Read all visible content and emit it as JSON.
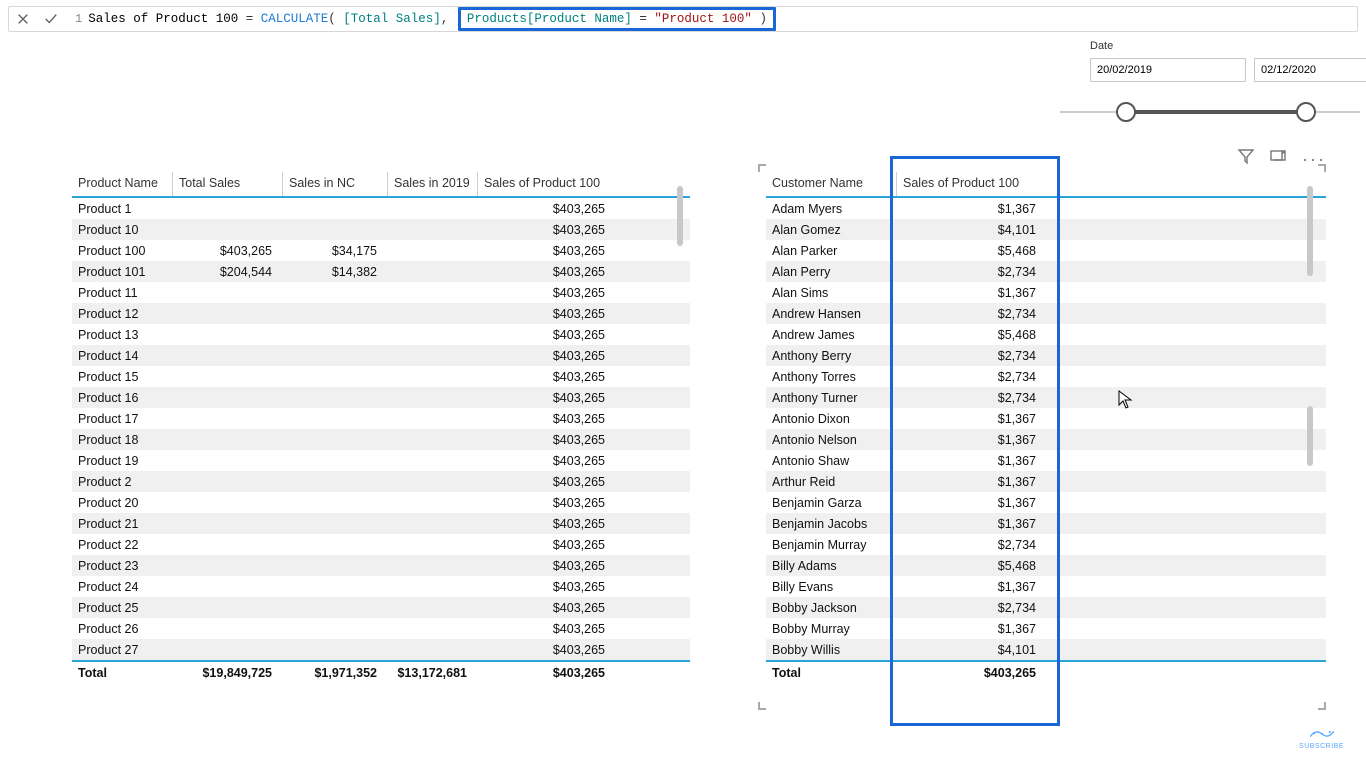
{
  "formula": {
    "line_no": "1",
    "measure_name": "Sales of Product 100",
    "equals": " = ",
    "func": "CALCULATE",
    "open": "(",
    "arg1_open": " [",
    "arg1": "Total Sales",
    "arg1_close": "]",
    "comma": ", ",
    "filter_table": "Products",
    "filter_col_open": "[",
    "filter_col": "Product Name",
    "filter_col_close": "]",
    "filter_op": " = ",
    "filter_val": "\"Product 100\"",
    "close": " )"
  },
  "date_slicer": {
    "label": "Date",
    "start": "20/02/2019",
    "end": "02/12/2020"
  },
  "products_table": {
    "headers": [
      "Product Name",
      "Total Sales",
      "Sales in NC",
      "Sales in 2019",
      "Sales of Product 100"
    ],
    "rows": [
      {
        "name": "Product 1",
        "ts": "",
        "nc": "",
        "y": "",
        "p100": "$403,265"
      },
      {
        "name": "Product 10",
        "ts": "",
        "nc": "",
        "y": "",
        "p100": "$403,265"
      },
      {
        "name": "Product 100",
        "ts": "$403,265",
        "nc": "$34,175",
        "y": "",
        "p100": "$403,265"
      },
      {
        "name": "Product 101",
        "ts": "$204,544",
        "nc": "$14,382",
        "y": "",
        "p100": "$403,265"
      },
      {
        "name": "Product 11",
        "ts": "",
        "nc": "",
        "y": "",
        "p100": "$403,265"
      },
      {
        "name": "Product 12",
        "ts": "",
        "nc": "",
        "y": "",
        "p100": "$403,265"
      },
      {
        "name": "Product 13",
        "ts": "",
        "nc": "",
        "y": "",
        "p100": "$403,265"
      },
      {
        "name": "Product 14",
        "ts": "",
        "nc": "",
        "y": "",
        "p100": "$403,265"
      },
      {
        "name": "Product 15",
        "ts": "",
        "nc": "",
        "y": "",
        "p100": "$403,265"
      },
      {
        "name": "Product 16",
        "ts": "",
        "nc": "",
        "y": "",
        "p100": "$403,265"
      },
      {
        "name": "Product 17",
        "ts": "",
        "nc": "",
        "y": "",
        "p100": "$403,265"
      },
      {
        "name": "Product 18",
        "ts": "",
        "nc": "",
        "y": "",
        "p100": "$403,265"
      },
      {
        "name": "Product 19",
        "ts": "",
        "nc": "",
        "y": "",
        "p100": "$403,265"
      },
      {
        "name": "Product 2",
        "ts": "",
        "nc": "",
        "y": "",
        "p100": "$403,265"
      },
      {
        "name": "Product 20",
        "ts": "",
        "nc": "",
        "y": "",
        "p100": "$403,265"
      },
      {
        "name": "Product 21",
        "ts": "",
        "nc": "",
        "y": "",
        "p100": "$403,265"
      },
      {
        "name": "Product 22",
        "ts": "",
        "nc": "",
        "y": "",
        "p100": "$403,265"
      },
      {
        "name": "Product 23",
        "ts": "",
        "nc": "",
        "y": "",
        "p100": "$403,265"
      },
      {
        "name": "Product 24",
        "ts": "",
        "nc": "",
        "y": "",
        "p100": "$403,265"
      },
      {
        "name": "Product 25",
        "ts": "",
        "nc": "",
        "y": "",
        "p100": "$403,265"
      },
      {
        "name": "Product 26",
        "ts": "",
        "nc": "",
        "y": "",
        "p100": "$403,265"
      },
      {
        "name": "Product 27",
        "ts": "",
        "nc": "",
        "y": "",
        "p100": "$403,265"
      }
    ],
    "total": {
      "label": "Total",
      "ts": "$19,849,725",
      "nc": "$1,971,352",
      "y": "$13,172,681",
      "p100": "$403,265"
    }
  },
  "customers_table": {
    "headers": [
      "Customer Name",
      "Sales of Product 100"
    ],
    "rows": [
      {
        "name": "Adam Myers",
        "v": "$1,367"
      },
      {
        "name": "Alan Gomez",
        "v": "$4,101"
      },
      {
        "name": "Alan Parker",
        "v": "$5,468"
      },
      {
        "name": "Alan Perry",
        "v": "$2,734"
      },
      {
        "name": "Alan Sims",
        "v": "$1,367"
      },
      {
        "name": "Andrew Hansen",
        "v": "$2,734"
      },
      {
        "name": "Andrew James",
        "v": "$5,468"
      },
      {
        "name": "Anthony Berry",
        "v": "$2,734"
      },
      {
        "name": "Anthony Torres",
        "v": "$2,734"
      },
      {
        "name": "Anthony Turner",
        "v": "$2,734"
      },
      {
        "name": "Antonio Dixon",
        "v": "$1,367"
      },
      {
        "name": "Antonio Nelson",
        "v": "$1,367"
      },
      {
        "name": "Antonio Shaw",
        "v": "$1,367"
      },
      {
        "name": "Arthur Reid",
        "v": "$1,367"
      },
      {
        "name": "Benjamin Garza",
        "v": "$1,367"
      },
      {
        "name": "Benjamin Jacobs",
        "v": "$1,367"
      },
      {
        "name": "Benjamin Murray",
        "v": "$2,734"
      },
      {
        "name": "Billy Adams",
        "v": "$5,468"
      },
      {
        "name": "Billy Evans",
        "v": "$1,367"
      },
      {
        "name": "Bobby Jackson",
        "v": "$2,734"
      },
      {
        "name": "Bobby Murray",
        "v": "$1,367"
      },
      {
        "name": "Bobby Willis",
        "v": "$4,101"
      }
    ],
    "total": {
      "label": "Total",
      "v": "$403,265"
    }
  },
  "logo_text": "SUBSCRIBE"
}
